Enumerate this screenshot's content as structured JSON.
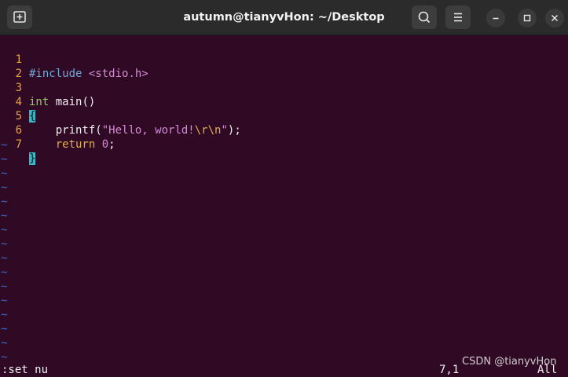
{
  "window": {
    "title": "autumn@tianyvHon: ~/Desktop",
    "icons": {
      "new_tab": "new-tab-icon",
      "search": "search-icon",
      "menu": "hamburger-menu-icon",
      "minimize": "minimize-icon",
      "maximize": "maximize-icon",
      "close": "close-icon"
    }
  },
  "code": {
    "line_numbers": [
      "1",
      "2",
      "3",
      "4",
      "5",
      "6",
      "7"
    ],
    "l1": {
      "directive": "#include",
      "sep": " ",
      "header": "<stdio.h>"
    },
    "l3": {
      "type": "int",
      "rest": " main()"
    },
    "l4": {
      "brace": "{"
    },
    "l5": {
      "indent": "    ",
      "fn": "printf(",
      "str1": "\"Hello, world!",
      "esc": "\\r\\n",
      "str2": "\"",
      "end": ");"
    },
    "l6": {
      "indent": "    ",
      "kw": "return",
      "sep": " ",
      "num": "0",
      "end": ";"
    },
    "l7": {
      "brace": "}"
    }
  },
  "tilde": "~",
  "status": {
    "command": ":set nu",
    "position": "7,1",
    "scroll": "All"
  },
  "watermark": "CSDN @tianyvHon",
  "colors": {
    "background": "#300a24",
    "titlebar": "#2b2b2b",
    "line_number": "#e8a33c",
    "tilde": "#3f68c9",
    "brace_match": "#34b5c4"
  }
}
